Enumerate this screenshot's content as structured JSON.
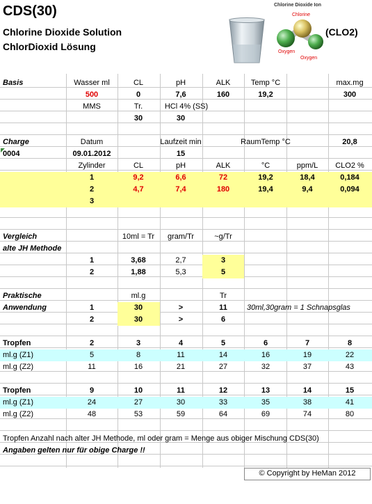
{
  "header": {
    "title": "CDS(30)",
    "subtitle_en": "Chlorine Dioxide Solution",
    "subtitle_de": "ChlorDioxid Lösung",
    "formula": "(CLO2)",
    "molecule_caption": "Chlorine Dioxide Ion",
    "molecule_chlorine": "Chlorine",
    "molecule_oxygen_left": "Oxygen",
    "molecule_oxygen_right": "Oxygen"
  },
  "basis": {
    "label": "Basis",
    "headers": [
      "Wasser ml",
      "CL",
      "pH",
      "ALK",
      "Temp °C",
      "max.mg"
    ],
    "values": [
      "500",
      "0",
      "7,6",
      "160",
      "19,2",
      "300"
    ],
    "row2_labels": [
      "MMS",
      "Tr.",
      "HCl  4% (SS)"
    ],
    "row3_values": [
      "30",
      "30"
    ]
  },
  "charge": {
    "label": "Charge",
    "datum_label": "Datum",
    "laufzeit_label": "Laufzeit min",
    "raumtemp_label": "RaumTemp °C",
    "raumtemp_value": "20,8",
    "number": "0004",
    "date": "09.01.2012",
    "laufzeit_value": "15",
    "headers": [
      "Zylinder",
      "CL",
      "pH",
      "ALK",
      "°C",
      "ppm/L",
      "CLO2 %"
    ],
    "rows": [
      [
        "1",
        "9,2",
        "6,6",
        "72",
        "19,2",
        "18,4",
        "0,184"
      ],
      [
        "2",
        "4,7",
        "7,4",
        "180",
        "19,4",
        "9,4",
        "0,094"
      ],
      [
        "3",
        "",
        "",
        "",
        "",
        "",
        ""
      ]
    ]
  },
  "vergleich": {
    "label": "Vergleich",
    "sublabel": "alte JH Methode",
    "headers": [
      "10ml = Tr",
      "gram/Tr",
      "~g/Tr"
    ],
    "rows": [
      [
        "1",
        "3,68",
        "2,7",
        "3"
      ],
      [
        "2",
        "1,88",
        "5,3",
        "5"
      ]
    ]
  },
  "praktische": {
    "label": "Praktische",
    "sublabel": "Anwendung",
    "headers": [
      "ml.g",
      "Tr"
    ],
    "rows": [
      [
        "1",
        "30",
        ">",
        "11"
      ],
      [
        "2",
        "30",
        ">",
        "6"
      ]
    ],
    "note": "30ml,30gram = 1 Schnapsglas"
  },
  "tropfen1": {
    "label": "Tropfen",
    "cols": [
      "2",
      "3",
      "4",
      "5",
      "6",
      "7",
      "8"
    ],
    "z1_label": "ml.g (Z1)",
    "z1": [
      "5",
      "8",
      "11",
      "14",
      "16",
      "19",
      "22"
    ],
    "z2_label": "ml.g (Z2)",
    "z2": [
      "11",
      "16",
      "21",
      "27",
      "32",
      "37",
      "43"
    ]
  },
  "tropfen2": {
    "label": "Tropfen",
    "cols": [
      "9",
      "10",
      "11",
      "12",
      "13",
      "14",
      "15"
    ],
    "z1_label": "ml.g (Z1)",
    "z1": [
      "24",
      "27",
      "30",
      "33",
      "35",
      "38",
      "41"
    ],
    "z2_label": "ml.g (Z2)",
    "z2": [
      "48",
      "53",
      "59",
      "64",
      "69",
      "74",
      "80"
    ]
  },
  "footer": {
    "note1": "Tropfen Anzahl nach alter JH Methode, ml oder gram = Menge aus obiger Mischung CDS(30)",
    "note2": "Angaben gelten nur für obige Charge !!",
    "copyright": "© Copyright by HeMan 2012"
  },
  "colors": {
    "yellow_highlight": "#ffff99",
    "cyan_highlight": "#ccffff",
    "red_value": "#e00000",
    "grid": "#c8c8c8"
  }
}
